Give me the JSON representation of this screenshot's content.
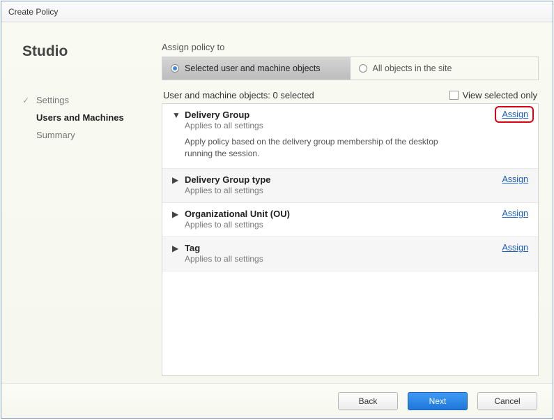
{
  "window": {
    "title": "Create Policy"
  },
  "sidebar": {
    "appName": "Studio",
    "items": [
      {
        "label": "Settings",
        "completed": true,
        "active": false
      },
      {
        "label": "Users and Machines",
        "completed": false,
        "active": true
      },
      {
        "label": "Summary",
        "completed": false,
        "active": false
      }
    ]
  },
  "main": {
    "assignLabel": "Assign policy to",
    "options": {
      "selectedObjects": "Selected user and machine objects",
      "allObjects": "All objects in the site"
    },
    "listHeader": "User and machine objects: 0 selected",
    "viewSelectedOnly": "View selected only",
    "assignLink": "Assign",
    "items": [
      {
        "title": "Delivery Group",
        "sub": "Applies to all settings",
        "expanded": true,
        "desc": "Apply policy based on the delivery group membership of the desktop running the session.",
        "highlight": true
      },
      {
        "title": "Delivery Group type",
        "sub": "Applies to all settings",
        "expanded": false
      },
      {
        "title": "Organizational Unit (OU)",
        "sub": "Applies to all settings",
        "expanded": false
      },
      {
        "title": "Tag",
        "sub": "Applies to all settings",
        "expanded": false
      }
    ]
  },
  "footer": {
    "back": "Back",
    "next": "Next",
    "cancel": "Cancel"
  }
}
